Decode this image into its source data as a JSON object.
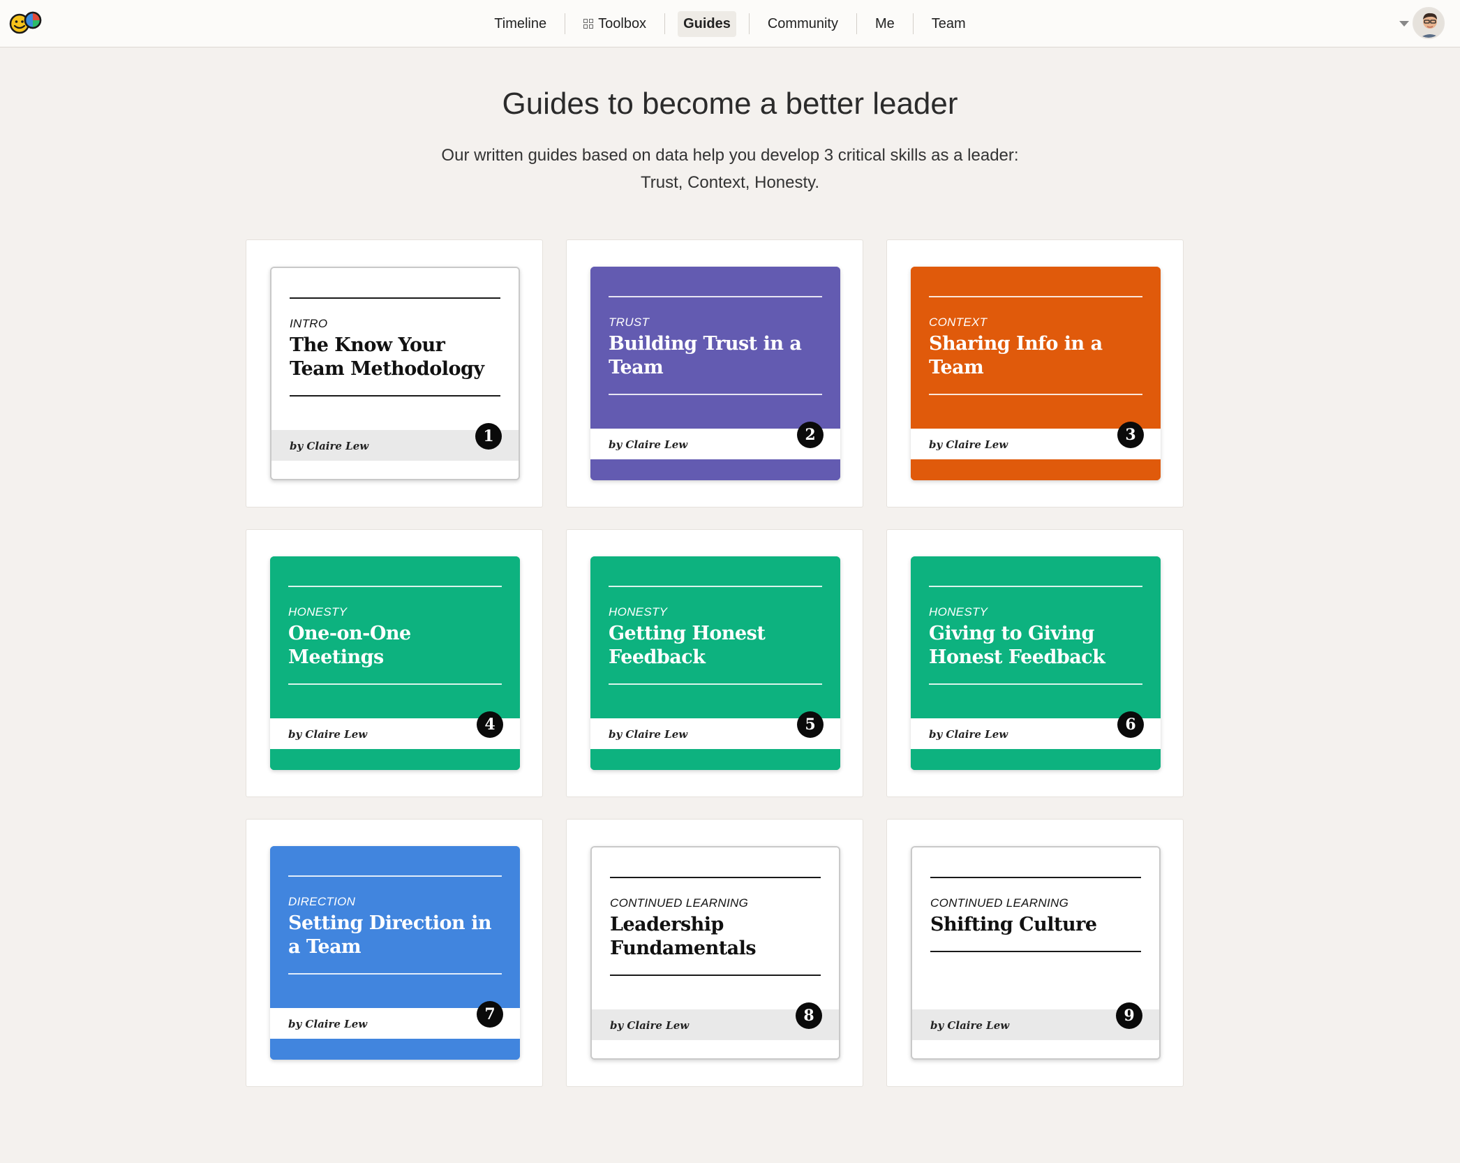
{
  "nav": {
    "items": [
      {
        "label": "Timeline",
        "active": false,
        "icon": null
      },
      {
        "label": "Toolbox",
        "active": false,
        "icon": "grid-icon"
      },
      {
        "label": "Guides",
        "active": true,
        "icon": null
      },
      {
        "label": "Community",
        "active": false,
        "icon": null
      },
      {
        "label": "Me",
        "active": false,
        "icon": null
      },
      {
        "label": "Team",
        "active": false,
        "icon": null
      }
    ]
  },
  "header": {
    "title": "Guides to become a better leader",
    "subtitle_line1": "Our written guides based on data help you develop 3 critical skills as a leader:",
    "subtitle_line2": "Trust, Context, Honesty."
  },
  "guides": [
    {
      "category": "INTRO",
      "title": "The Know Your Team Methodology",
      "author": "by Claire Lew",
      "number": "1",
      "style": "plain",
      "color": "#ffffff"
    },
    {
      "category": "TRUST",
      "title": "Building Trust in a Team",
      "author": "by Claire Lew",
      "number": "2",
      "style": "colored",
      "color": "#635bb1"
    },
    {
      "category": "CONTEXT",
      "title": "Sharing Info in a Team",
      "author": "by Claire Lew",
      "number": "3",
      "style": "colored",
      "color": "#e05a0b"
    },
    {
      "category": "HONESTY",
      "title": "One-on-One Meetings",
      "author": "by Claire Lew",
      "number": "4",
      "style": "colored",
      "color": "#0db27f"
    },
    {
      "category": "HONESTY",
      "title": "Getting Honest Feedback",
      "author": "by Claire Lew",
      "number": "5",
      "style": "colored",
      "color": "#0db27f"
    },
    {
      "category": "HONESTY",
      "title": "Giving to Giving Honest Feedback",
      "author": "by Claire Lew",
      "number": "6",
      "style": "colored",
      "color": "#0db27f"
    },
    {
      "category": "DIRECTION",
      "title": "Setting Direction in a Team",
      "author": "by Claire Lew",
      "number": "7",
      "style": "colored",
      "color": "#4185de"
    },
    {
      "category": "CONTINUED LEARNING",
      "title": "Leadership Fundamentals",
      "author": "by Claire Lew",
      "number": "8",
      "style": "plain",
      "color": "#ffffff"
    },
    {
      "category": "CONTINUED LEARNING",
      "title": "Shifting Culture",
      "author": "by Claire Lew",
      "number": "9",
      "style": "plain",
      "color": "#ffffff"
    }
  ]
}
